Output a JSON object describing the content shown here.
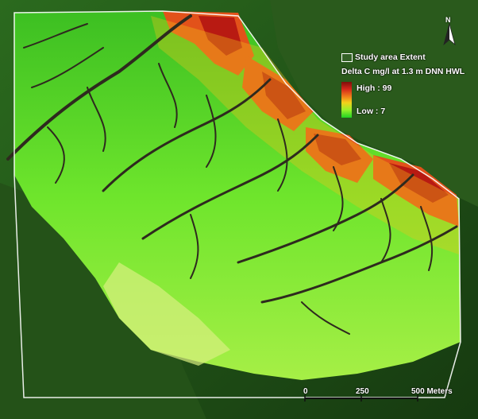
{
  "legend": {
    "extent_label": "Study area Extent",
    "title": "Delta C mg/l at 1.3 m DNN HWL",
    "high_label": "High : 99",
    "low_label": "Low : 7",
    "high_value": 99,
    "low_value": 7,
    "ramp_colors": [
      "#7d0f0a",
      "#d4261a",
      "#f07a1a",
      "#f4d11a",
      "#9bf02a",
      "#1fd323"
    ]
  },
  "north_arrow": {
    "label": "N"
  },
  "scale_bar": {
    "labels": [
      "0",
      "250",
      "500 Meters"
    ],
    "unit": "Meters",
    "stops": [
      0,
      250,
      500
    ]
  },
  "colors": {
    "lowland": "#4fd32a",
    "highland_dark": "#2a5a1c",
    "tidal_high": "#d4261a",
    "channel": "#2e2a1e",
    "extent_outline": "#ffffff"
  },
  "icons": {
    "north": "north-arrow-icon",
    "extent": "rectangle-outline-icon",
    "ramp": "color-ramp-icon"
  }
}
